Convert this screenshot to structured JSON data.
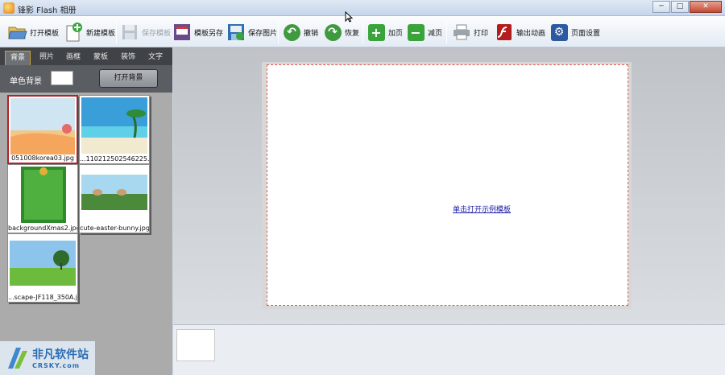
{
  "window": {
    "title": "锋影 Flash 相册",
    "controls": {
      "minimize": "─",
      "maximize": "□",
      "close": "✕"
    }
  },
  "toolbar": {
    "open_template": {
      "label": "打开模板",
      "icon": "folder-open-icon"
    },
    "new_template": {
      "label": "新建模板",
      "icon": "new-document-icon"
    },
    "save_template": {
      "label": "保存模板",
      "icon": "save-disk-icon",
      "disabled": true
    },
    "save_template_as": {
      "label": "模板另存",
      "icon": "save-as-icon"
    },
    "save_image": {
      "label": "保存图片",
      "icon": "save-image-icon"
    },
    "undo": {
      "label": "撤销",
      "icon": "undo-icon"
    },
    "redo": {
      "label": "恢复",
      "icon": "redo-icon"
    },
    "add_page": {
      "label": "加页",
      "icon": "plus-icon"
    },
    "remove_page": {
      "label": "减页",
      "icon": "minus-icon"
    },
    "print": {
      "label": "打印",
      "icon": "printer-icon"
    },
    "export_animation": {
      "label": "输出动画",
      "icon": "flash-icon"
    },
    "page_setup": {
      "label": "页面设置",
      "icon": "gear-icon"
    }
  },
  "left_panel": {
    "tabs": [
      "背景",
      "照片",
      "画框",
      "蒙板",
      "装饰",
      "文字"
    ],
    "active_tab": "背景",
    "solid_bg_label": "单色背景",
    "solid_bg_color": "#ffffff",
    "open_bg_button": "打开背景",
    "thumbnails": [
      {
        "caption": "051008korea03.jpg",
        "selected": true
      },
      {
        "caption": "...110212502546225.jpg",
        "selected": false
      },
      {
        "caption": "backgroundXmas2.jpg",
        "selected": false
      },
      {
        "caption": "cute-easter-bunny.jpg",
        "selected": false
      },
      {
        "caption": "...scape-JF118_350A.jpg",
        "selected": false
      }
    ]
  },
  "canvas": {
    "sample_link": "单击打开示例模板"
  },
  "watermark": {
    "name": "非凡软件站",
    "domain": "CRSKY.com"
  },
  "colors": {
    "accent_red": "#b0222a",
    "link_blue": "#1a1aa8",
    "dark_panel": "#3f4246",
    "page_border": "#e55a4e"
  }
}
